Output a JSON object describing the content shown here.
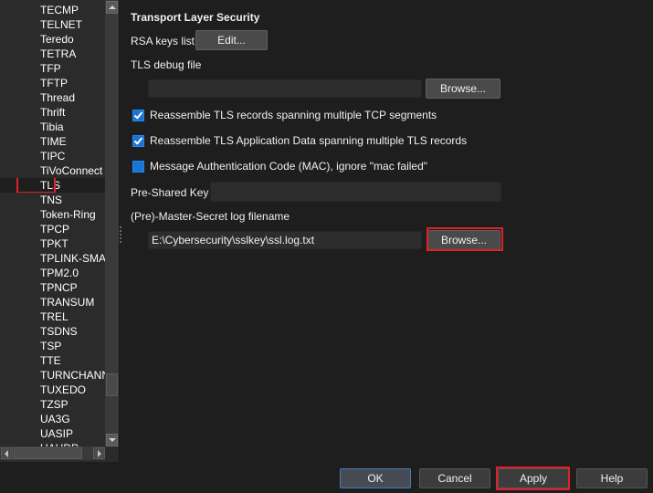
{
  "sidebar": {
    "items": [
      {
        "label": "TECMP",
        "selected": false
      },
      {
        "label": "TELNET",
        "selected": false
      },
      {
        "label": "Teredo",
        "selected": false
      },
      {
        "label": "TETRA",
        "selected": false
      },
      {
        "label": "TFP",
        "selected": false
      },
      {
        "label": "TFTP",
        "selected": false
      },
      {
        "label": "Thread",
        "selected": false
      },
      {
        "label": "Thrift",
        "selected": false
      },
      {
        "label": "Tibia",
        "selected": false
      },
      {
        "label": "TIME",
        "selected": false
      },
      {
        "label": "TIPC",
        "selected": false
      },
      {
        "label": "TiVoConnect",
        "selected": false
      },
      {
        "label": "TLS",
        "selected": true
      },
      {
        "label": "TNS",
        "selected": false
      },
      {
        "label": "Token-Ring",
        "selected": false
      },
      {
        "label": "TPCP",
        "selected": false
      },
      {
        "label": "TPKT",
        "selected": false
      },
      {
        "label": "TPLINK-SMART",
        "selected": false
      },
      {
        "label": "TPM2.0",
        "selected": false
      },
      {
        "label": "TPNCP",
        "selected": false
      },
      {
        "label": "TRANSUM",
        "selected": false
      },
      {
        "label": "TREL",
        "selected": false
      },
      {
        "label": "TSDNS",
        "selected": false
      },
      {
        "label": "TSP",
        "selected": false
      },
      {
        "label": "TTE",
        "selected": false
      },
      {
        "label": "TURNCHANNEL",
        "selected": false
      },
      {
        "label": "TUXEDO",
        "selected": false
      },
      {
        "label": "TZSP",
        "selected": false
      },
      {
        "label": "UA3G",
        "selected": false
      },
      {
        "label": "UASIP",
        "selected": false
      },
      {
        "label": "UAUDP",
        "selected": false
      }
    ]
  },
  "panel": {
    "title": "Transport Layer Security",
    "rsa_keys_label": "RSA keys list",
    "rsa_edit_button": "Edit...",
    "debug_file_label": "TLS debug file",
    "debug_file_value": "",
    "debug_browse_button": "Browse...",
    "checkboxes": [
      {
        "label": "Reassemble TLS records spanning multiple TCP segments",
        "checked": true
      },
      {
        "label": "Reassemble TLS Application Data spanning multiple TLS records",
        "checked": true
      },
      {
        "label": "Message Authentication Code (MAC), ignore \"mac failed\"",
        "checked": false
      }
    ],
    "psk_label": "Pre-Shared Key",
    "psk_value": "",
    "master_secret_label": "(Pre)-Master-Secret log filename",
    "master_secret_value": "E:\\Cybersecurity\\sslkey\\ssl.log.txt",
    "master_secret_browse_button": "Browse..."
  },
  "footer": {
    "ok": "OK",
    "cancel": "Cancel",
    "apply": "Apply",
    "help": "Help"
  },
  "colors": {
    "highlight_annotation": "#e0202a",
    "checkbox_accent": "#1874d6"
  }
}
